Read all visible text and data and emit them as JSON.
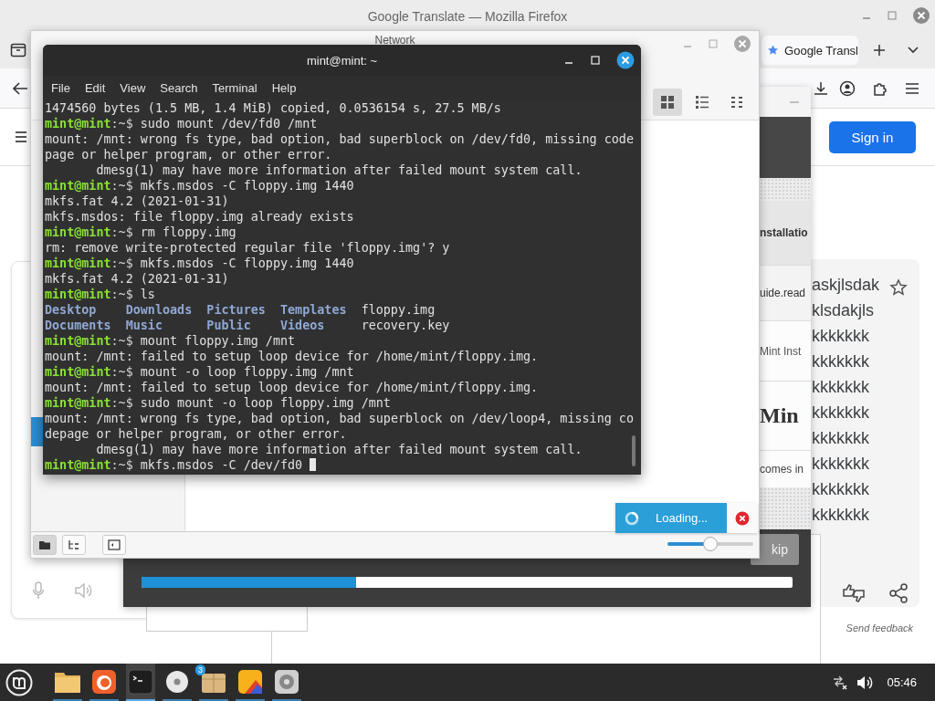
{
  "firefox": {
    "title": "Google Translate — Mozilla Firefox",
    "tab": {
      "label": "Google Transl",
      "selected": true
    },
    "sign_in": "Sign in",
    "translation_lines": [
      "askjlsdak",
      "klsdakjls",
      "kkkkkkk",
      "kkkkkkk",
      "kkkkkkk",
      "kkkkkkk",
      "kkkkkkk",
      "kkkkkkk",
      "kkkkkkk",
      "kkkkkkk"
    ],
    "send_feedback": "Send feedback"
  },
  "installer": {
    "fragments": [
      {
        "kind": "section",
        "text": "nstallatio"
      },
      {
        "kind": "url",
        "text": "uide.read"
      },
      {
        "kind": "text",
        "text": "Mint Inst"
      },
      {
        "kind": "heading",
        "text": "Min"
      },
      {
        "kind": "body",
        "text": "comes in"
      }
    ],
    "progress": {
      "level": 0.33
    },
    "skip": {
      "label": "kip",
      "disabled": true
    }
  },
  "file_manager": {
    "title": "Network",
    "views": [
      {
        "kind": "grid",
        "selected": true
      },
      {
        "kind": "list",
        "selected": false
      },
      {
        "kind": "compact",
        "selected": false
      }
    ],
    "panes": [
      {
        "kind": "places",
        "selected": true
      },
      {
        "kind": "tree",
        "selected": false
      }
    ],
    "zoom": {
      "level": 0.5
    }
  },
  "loading": {
    "label": "Loading..."
  },
  "terminal": {
    "title": "mint@mint: ~",
    "menu": [
      "File",
      "Edit",
      "View",
      "Search",
      "Terminal",
      "Help"
    ],
    "cursor": true,
    "lines": [
      {
        "kind": "output",
        "text": "1474560 bytes (1.5 MB, 1.4 MiB) copied, 0.0536154 s, 27.5 MB/s"
      },
      {
        "kind": "prompt",
        "user": "mint@mint",
        "path": ":~$",
        "command": "sudo mount /dev/fd0 /mnt"
      },
      {
        "kind": "output",
        "text": "mount: /mnt: wrong fs type, bad option, bad superblock on /dev/fd0, missing code"
      },
      {
        "kind": "output",
        "text": "page or helper program, or other error."
      },
      {
        "kind": "output",
        "text": "       dmesg(1) may have more information after failed mount system call."
      },
      {
        "kind": "prompt",
        "user": "mint@mint",
        "path": ":~$",
        "command": "mkfs.msdos -C floppy.img 1440"
      },
      {
        "kind": "output",
        "text": "mkfs.fat 4.2 (2021-01-31)"
      },
      {
        "kind": "output",
        "text": "mkfs.msdos: file floppy.img already exists"
      },
      {
        "kind": "prompt",
        "user": "mint@mint",
        "path": ":~$",
        "command": "rm floppy.img"
      },
      {
        "kind": "output",
        "text": "rm: remove write-protected regular file 'floppy.img'? y"
      },
      {
        "kind": "prompt",
        "user": "mint@mint",
        "path": ":~$",
        "command": "mkfs.msdos -C floppy.img 1440"
      },
      {
        "kind": "output",
        "text": "mkfs.fat 4.2 (2021-01-31)"
      },
      {
        "kind": "prompt",
        "user": "mint@mint",
        "path": ":~$",
        "command": "ls"
      },
      {
        "kind": "ls",
        "entries": [
          {
            "text": "Desktop",
            "kind": "dir"
          },
          {
            "text": "Downloads",
            "kind": "dir"
          },
          {
            "text": "Pictures",
            "kind": "dir"
          },
          {
            "text": "Templates",
            "kind": "dir"
          },
          {
            "text": "floppy.img",
            "kind": "file"
          }
        ]
      },
      {
        "kind": "ls",
        "entries": [
          {
            "text": "Documents",
            "kind": "dir"
          },
          {
            "text": "Music",
            "kind": "dir"
          },
          {
            "text": "Public",
            "kind": "dir"
          },
          {
            "text": "Videos",
            "kind": "dir"
          },
          {
            "text": "recovery.key",
            "kind": "file"
          }
        ]
      },
      {
        "kind": "prompt",
        "user": "mint@mint",
        "path": ":~$",
        "command": "mount floppy.img /mnt"
      },
      {
        "kind": "output",
        "text": "mount: /mnt: failed to setup loop device for /home/mint/floppy.img."
      },
      {
        "kind": "prompt",
        "user": "mint@mint",
        "path": ":~$",
        "command": "mount -o loop floppy.img /mnt"
      },
      {
        "kind": "output",
        "text": "mount: /mnt: failed to setup loop device for /home/mint/floppy.img."
      },
      {
        "kind": "prompt",
        "user": "mint@mint",
        "path": ":~$",
        "command": "sudo mount -o loop floppy.img /mnt"
      },
      {
        "kind": "output",
        "text": "mount: /mnt: wrong fs type, bad option, bad superblock on /dev/loop4, missing co"
      },
      {
        "kind": "output",
        "text": "depage or helper program, or other error."
      },
      {
        "kind": "output",
        "text": "       dmesg(1) may have more information after failed mount system call."
      },
      {
        "kind": "prompt",
        "user": "mint@mint",
        "path": ":~$",
        "command": "mkfs.msdos -C /dev/fd0"
      }
    ]
  },
  "taskbar": {
    "apps": [
      {
        "kind": "files",
        "active": false
      },
      {
        "kind": "firefox",
        "active": false
      },
      {
        "kind": "terminal",
        "active": true
      },
      {
        "kind": "disc",
        "active": false
      },
      {
        "kind": "package",
        "active": false,
        "badge": "3"
      },
      {
        "kind": "viewer",
        "active": false
      },
      {
        "kind": "disks",
        "active": false
      }
    ],
    "clock": "05:46"
  }
}
